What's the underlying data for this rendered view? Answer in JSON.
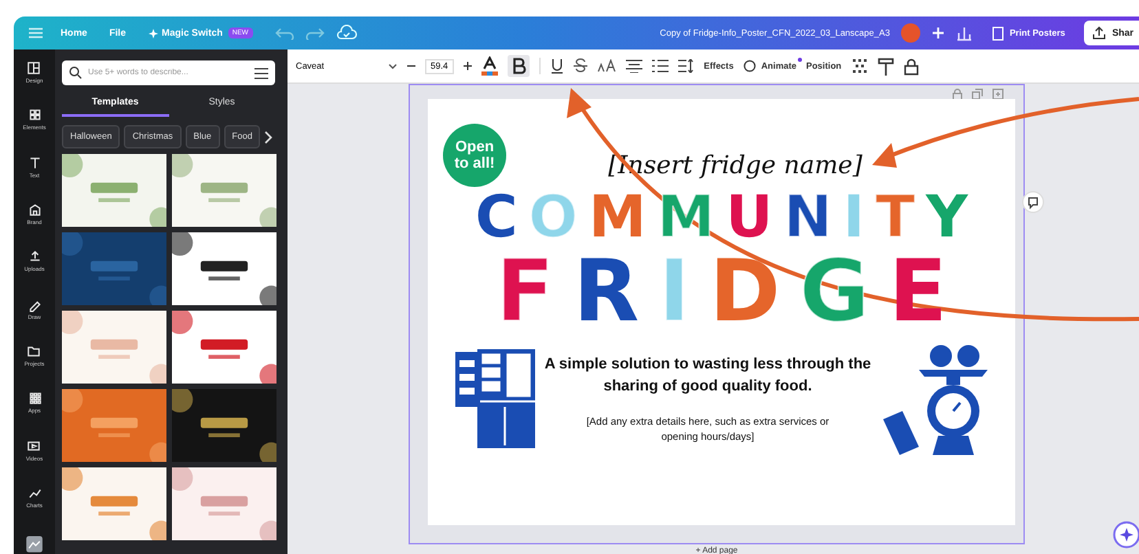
{
  "topbar": {
    "menu": [
      "Home",
      "File"
    ],
    "magic_switch": {
      "label": "Magic Switch",
      "badge": "NEW"
    },
    "document_title": "Copy of Fridge-Info_Poster_CFN_2022_03_Lanscape_A3",
    "print_button": "Print Posters",
    "share_button": "Shar"
  },
  "rail": [
    {
      "label": "Design",
      "kind": "design"
    },
    {
      "label": "Elements",
      "kind": "elements"
    },
    {
      "label": "Text",
      "kind": "text"
    },
    {
      "label": "Brand",
      "kind": "brand"
    },
    {
      "label": "Uploads",
      "kind": "uploads"
    },
    {
      "label": "Draw",
      "kind": "draw"
    },
    {
      "label": "Projects",
      "kind": "projects"
    },
    {
      "label": "Apps",
      "kind": "apps"
    },
    {
      "label": "Videos",
      "kind": "videos"
    },
    {
      "label": "Charts",
      "kind": "charts"
    }
  ],
  "panel": {
    "search": {
      "placeholder": "Use 5+ words to describe..."
    },
    "tabs": [
      {
        "label": "Templates",
        "selected": true
      },
      {
        "label": "Styles",
        "selected": false
      }
    ],
    "chips": [
      "Halloween",
      "Christmas",
      "Blue",
      "Food"
    ]
  },
  "toolbar": {
    "font": "Caveat",
    "size": "59.4",
    "bold": true,
    "effects": "Effects",
    "animate": "Animate",
    "position": "Position"
  },
  "poster": {
    "badge": "Open to all!",
    "heading": "[Insert fridge name]",
    "line_1": [
      {
        "letter": "C",
        "color": "#1a4db3",
        "kind": "solid"
      },
      {
        "letter": "O",
        "color": "#8fd6ea",
        "kind": "dotted"
      },
      {
        "letter": "M",
        "color": "#e5652b",
        "kind": "solid"
      },
      {
        "letter": "M",
        "color": "#16a66b",
        "kind": "dotted"
      },
      {
        "letter": "U",
        "color": "#de1250",
        "kind": "solid"
      },
      {
        "letter": "N",
        "color": "#1a4db3",
        "kind": "dotted"
      },
      {
        "letter": "I",
        "color": "#8fd6ea",
        "kind": "solid"
      },
      {
        "letter": "T",
        "color": "#e5652b",
        "kind": "dotted"
      },
      {
        "letter": "Y",
        "color": "#16a66b",
        "kind": "solid"
      }
    ],
    "line_2": [
      {
        "letter": "F",
        "color": "#de1250",
        "kind": "dotted"
      },
      {
        "letter": "R",
        "color": "#1a4db3",
        "kind": "solid"
      },
      {
        "letter": "I",
        "color": "#8fd6ea",
        "kind": "dotted"
      },
      {
        "letter": "D",
        "color": "#e5652b",
        "kind": "solid"
      },
      {
        "letter": "G",
        "color": "#16a66b",
        "kind": "dotted"
      },
      {
        "letter": "E",
        "color": "#de1250",
        "kind": "solid"
      }
    ],
    "tagline": "A simple solution to wasting less through the sharing of good quality food.",
    "details": "[Add any extra details here, such as extra services or opening hours/days]"
  },
  "add_page": "+ Add page"
}
